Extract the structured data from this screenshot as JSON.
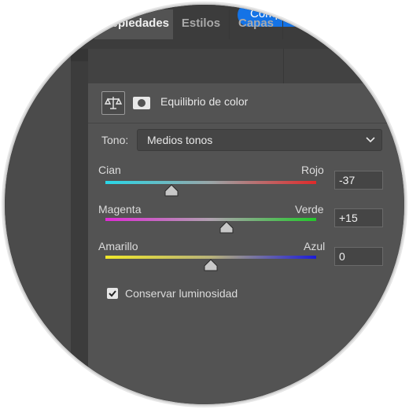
{
  "header": {
    "share_label": "Comp"
  },
  "tabs": [
    {
      "label": "Propiedades",
      "active": true
    },
    {
      "label": "Estilos",
      "active": false
    },
    {
      "label": "Capas",
      "active": false
    }
  ],
  "panel": {
    "title": "Equilibrio de color",
    "icons": [
      "balance-scale-icon",
      "mask-icon"
    ]
  },
  "tone": {
    "label": "Tono:",
    "value": "Medios tonos"
  },
  "sliders": [
    {
      "left_label": "Cian",
      "right_label": "Rojo",
      "value": "-37",
      "numeric": -37,
      "colors": [
        "#28d7e8",
        "#e02a2a"
      ]
    },
    {
      "left_label": "Magenta",
      "right_label": "Verde",
      "value": "+15",
      "numeric": 15,
      "colors": [
        "#e02ad6",
        "#22c92a"
      ]
    },
    {
      "left_label": "Amarillo",
      "right_label": "Azul",
      "value": "0",
      "numeric": 0,
      "colors": [
        "#f0e82a",
        "#1c1cd8"
      ]
    }
  ],
  "preserve": {
    "label": "Conservar luminosidad",
    "checked": true
  },
  "colors": {
    "accent": "#1473e6",
    "panel_bg": "#535353"
  }
}
